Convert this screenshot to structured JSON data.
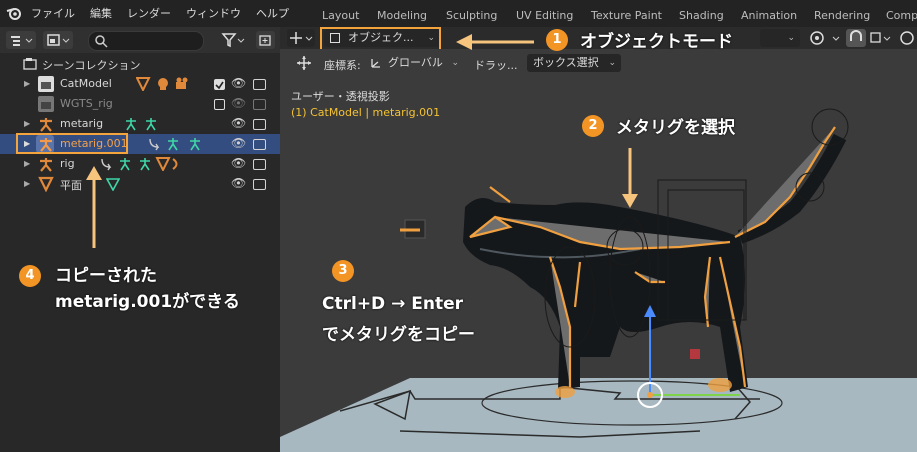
{
  "menu": {
    "file": "ファイル",
    "edit": "編集",
    "render": "レンダー",
    "window": "ウィンドウ",
    "help": "ヘルプ"
  },
  "workspaces": [
    "Layout",
    "Modeling",
    "Sculpting",
    "UV Editing",
    "Texture Paint",
    "Shading",
    "Animation",
    "Rendering",
    "Comp"
  ],
  "outliner": {
    "scene_collection": "シーンコレクション",
    "search_placeholder": "",
    "items": [
      {
        "label": "CatModel",
        "icon": "mesh-object-icon",
        "checked": true
      },
      {
        "label": "WGTS_rig",
        "icon": "collection-icon",
        "checked": false
      },
      {
        "label": "metarig",
        "icon": "armature-icon"
      },
      {
        "label": "metarig.001",
        "icon": "armature-icon",
        "selected": true
      },
      {
        "label": "rig",
        "icon": "armature-icon"
      },
      {
        "label": "平面",
        "icon": "mesh-icon"
      }
    ]
  },
  "viewport": {
    "mode_label": "オブジェク...",
    "coord_label": "座標系:",
    "coord_value": "グローバル",
    "drag_label": "ドラッ...",
    "select_mode": "ボックス選択",
    "view_name": "ユーザー・透視投影",
    "object_info": "(1) CatModel | metarig.001"
  },
  "annotations": {
    "step1": {
      "num": "1",
      "text": "オブジェクトモード"
    },
    "step2": {
      "num": "2",
      "text": "メタリグを選択"
    },
    "step3": {
      "num": "3",
      "line1": "Ctrl+D → Enter",
      "line2": "でメタリグをコピー"
    },
    "step4": {
      "num": "4",
      "line1": "コピーされた",
      "line2": "metarig.001ができる"
    }
  },
  "colors": {
    "accent": "#f39524",
    "highlight_border": "#f4a43c",
    "selected_row": "#334d80",
    "armature_green": "#3fd6a8",
    "mesh_orange": "#e0893a"
  }
}
